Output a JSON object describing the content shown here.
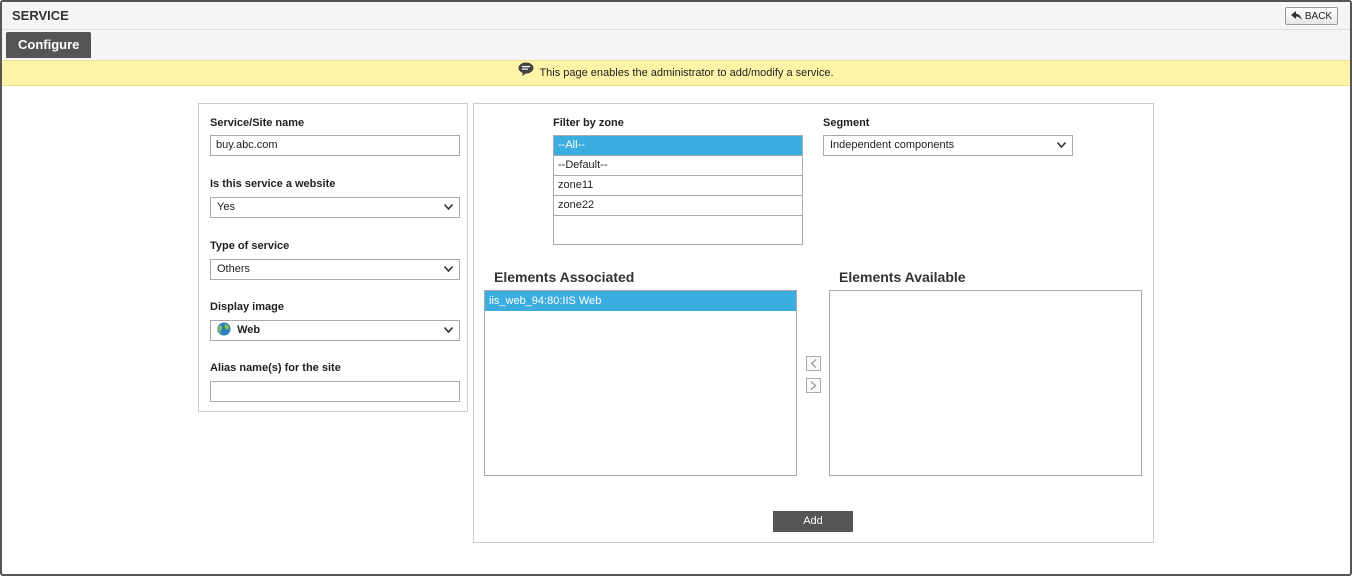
{
  "header": {
    "title": "SERVICE",
    "back_label": "BACK"
  },
  "tabs": [
    {
      "label": "Configure",
      "active": true
    }
  ],
  "info": {
    "message": "This page enables the administrator to add/modify a service."
  },
  "form": {
    "service_name": {
      "label": "Service/Site name",
      "value": "buy.abc.com"
    },
    "is_website": {
      "label": "Is this service a website",
      "value": "Yes"
    },
    "service_type": {
      "label": "Type of service",
      "value": "Others"
    },
    "display_image": {
      "label": "Display image",
      "value": "Web"
    },
    "alias": {
      "label": "Alias name(s) for the site",
      "value": ""
    }
  },
  "filter": {
    "label": "Filter by zone",
    "zones": [
      "--All--",
      "--Default--",
      "zone11",
      "zone22"
    ],
    "selected": "--All--"
  },
  "segment": {
    "label": "Segment",
    "value": "Independent components"
  },
  "elements_associated": {
    "title": "Elements Associated",
    "items": [
      "iis_web_94:80:IIS Web"
    ]
  },
  "elements_available": {
    "title": "Elements Available",
    "items": []
  },
  "actions": {
    "add_label": "Add"
  },
  "colors": {
    "accent": "#3badde",
    "info_bg": "#fff4a8",
    "tab_bg": "#555555"
  }
}
